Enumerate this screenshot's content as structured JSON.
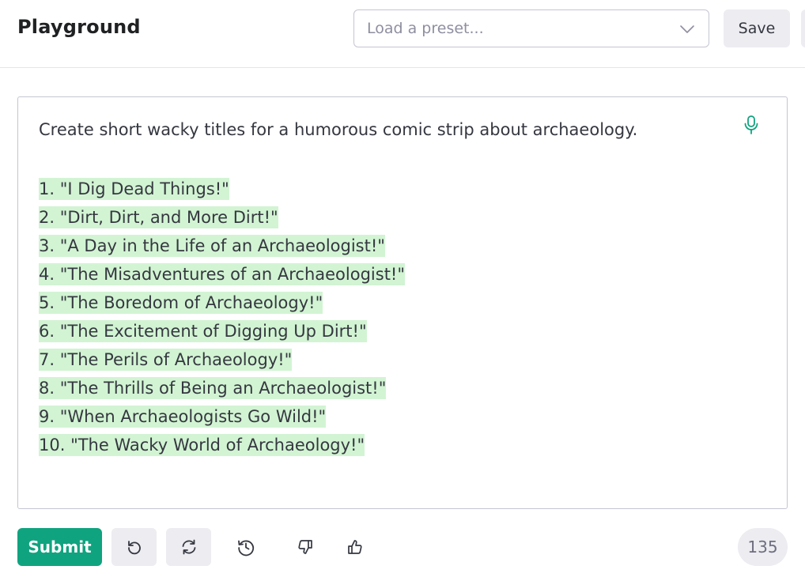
{
  "header": {
    "title": "Playground",
    "preset_placeholder": "Load a preset...",
    "save_label": "Save"
  },
  "editor": {
    "prompt": "Create short wacky titles for a humorous comic strip about archaeology.",
    "completion": [
      "1. \"I Dig Dead Things!\"",
      "2. \"Dirt, Dirt, and More Dirt!\"",
      "3. \"A Day in the Life of an Archaeologist!\"",
      "4. \"The Misadventures of an Archaeologist!\"",
      "5. \"The Boredom of Archaeology!\"",
      "6. \"The Excitement of Digging Up Dirt!\"",
      "7. \"The Perils of Archaeology!\"",
      "8. \"The Thrills of Being an Archaeologist!\"",
      "9. \"When Archaeologists Go Wild!\"",
      "10. \"The Wacky World of Archaeology!\""
    ],
    "mic_icon": "microphone-icon"
  },
  "toolbar": {
    "submit_label": "Submit",
    "undo_icon": "undo-icon",
    "regenerate_icon": "regenerate-icon",
    "history_icon": "history-icon",
    "thumbs_down_icon": "thumbs-down-icon",
    "thumbs_up_icon": "thumbs-up-icon",
    "token_count": "135"
  },
  "colors": {
    "accent": "#10a37f",
    "completion_highlight": "#d2f4d3",
    "button_gray": "#ececf1"
  }
}
